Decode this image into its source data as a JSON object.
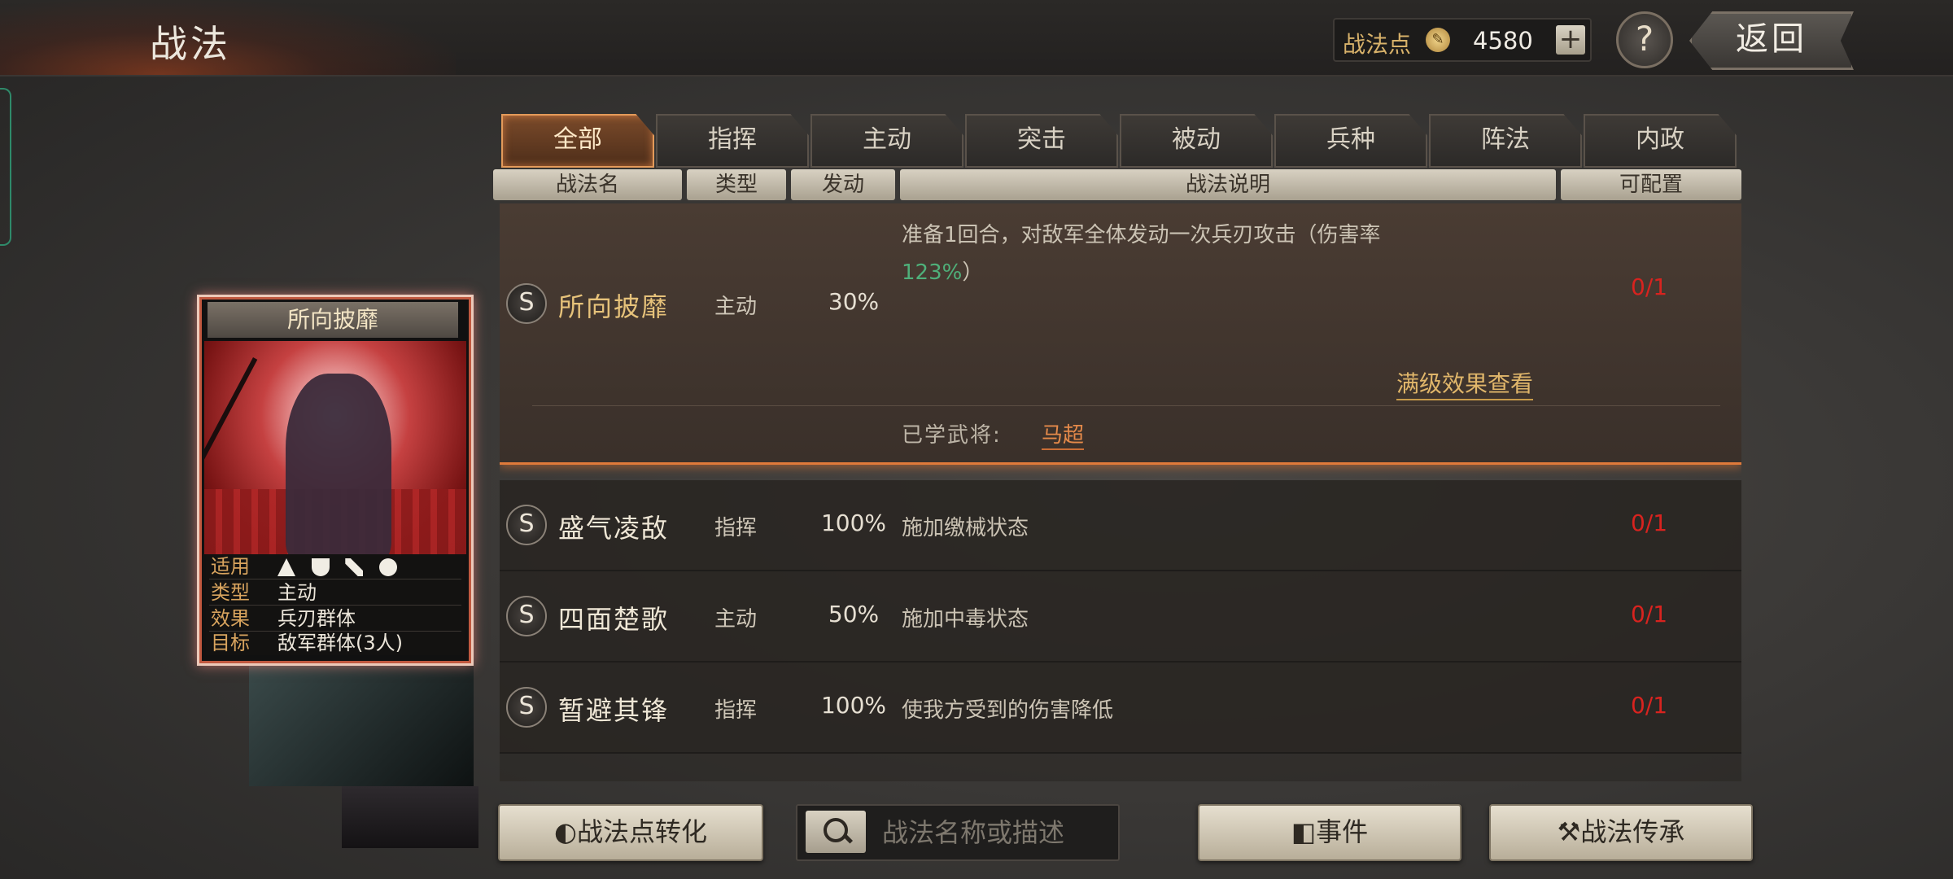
{
  "header": {
    "title": "战法"
  },
  "points": {
    "label": "战法点",
    "value": "4580",
    "add_label": "+"
  },
  "help_label": "?",
  "back_label": "返回",
  "tabs": [
    {
      "label": "全部",
      "active": true
    },
    {
      "label": "指挥"
    },
    {
      "label": "主动"
    },
    {
      "label": "突击"
    },
    {
      "label": "被动"
    },
    {
      "label": "兵种"
    },
    {
      "label": "阵法"
    },
    {
      "label": "内政"
    }
  ],
  "columns": {
    "name": "战法名",
    "type": "类型",
    "rate": "发动",
    "desc": "战法说明",
    "config": "可配置"
  },
  "skills": [
    {
      "grade": "S",
      "name": "所向披靡",
      "type": "主动",
      "rate": "30%",
      "desc_1": "准备1回合，对敌军全体发动一次兵刃攻击（伤害率",
      "desc_pct": "123%",
      "desc_end": "）",
      "config": "0/1",
      "max_level_link": "满级效果查看",
      "learned_label": "已学武将:",
      "learned_general": "马超"
    },
    {
      "grade": "S",
      "name": "盛气凌敌",
      "type": "指挥",
      "rate": "100%",
      "desc": "施加缴械状态",
      "config": "0/1"
    },
    {
      "grade": "S",
      "name": "四面楚歌",
      "type": "主动",
      "rate": "50%",
      "desc": "施加中毒状态",
      "config": "0/1"
    },
    {
      "grade": "S",
      "name": "暂避其锋",
      "type": "指挥",
      "rate": "100%",
      "desc": "使我方受到的伤害降低",
      "config": "0/1"
    }
  ],
  "card": {
    "title": "所向披靡",
    "applies_label": "适用",
    "applies_icons": [
      "cavalry-icon",
      "shield-icon",
      "bow-icon",
      "wheel-icon"
    ],
    "type_label": "类型",
    "type_value": "主动",
    "effect_label": "效果",
    "effect_value": "兵刃群体",
    "target_label": "目标",
    "target_value": "敌军群体(3人)"
  },
  "bottom": {
    "convert_label": "战法点转化",
    "search_placeholder": "战法名称或描述",
    "event_label": "事件",
    "inherit_label": "战法传承"
  },
  "colors": {
    "accent": "#e07a3a",
    "config_red": "#d8231f",
    "gold": "#e6c27a",
    "green": "#4fb07a"
  }
}
